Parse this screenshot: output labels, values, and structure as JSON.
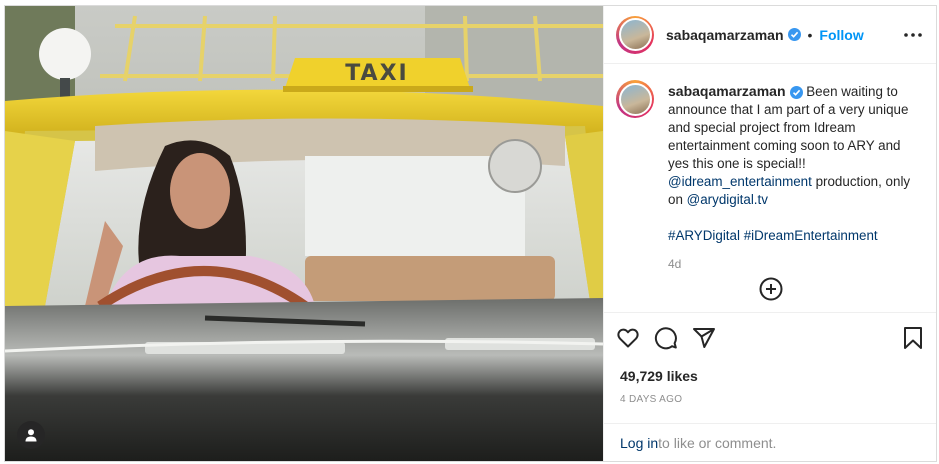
{
  "post": {
    "username": "sabaqamarzaman",
    "follow_label": "Follow",
    "separator": "•",
    "image_sign_text": "TAXI"
  },
  "caption": {
    "username": "sabaqamarzaman",
    "text_before": "Been waiting to announce that I am part of a very unique and special project from Idream entertainment coming soon to ARY and yes this one is special!!",
    "mention_1": "@idream_entertainment",
    "text_middle": " production, only on ",
    "mention_2": "@arydigital.tv",
    "hashtag_1": "#ARYDigital",
    "hashtag_2": "#iDreamEntertainment",
    "relative_time": "4d"
  },
  "stats": {
    "likes": "49,729 likes",
    "date": "4 DAYS AGO"
  },
  "footer": {
    "login_link": "Log in",
    "login_text": " to like or comment."
  },
  "colors": {
    "link_blue": "#0095f6",
    "mention_blue": "#00376b",
    "verified_blue": "#3897f0",
    "taxi_yellow": "#f0d12c"
  },
  "icons": {
    "options": "more-horizontal-icon",
    "like": "heart-icon",
    "comment": "comment-icon",
    "share": "paper-plane-icon",
    "save": "bookmark-icon",
    "add": "add-circle-icon",
    "user_tag": "user-icon"
  }
}
